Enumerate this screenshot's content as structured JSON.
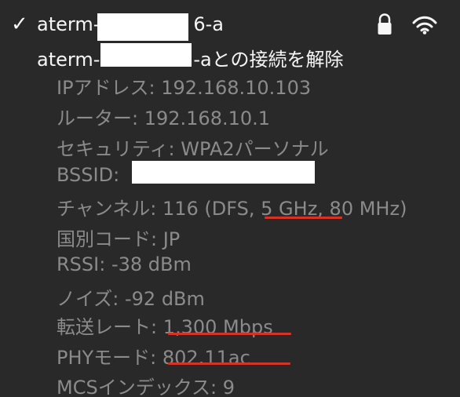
{
  "network": {
    "checkmark": "✓",
    "name_prefix": "aterm-",
    "name_suffix_visible": "6-a",
    "disconnect_prefix": "aterm-",
    "disconnect_suffix": "-aとの接続を解除",
    "lock_icon": "lock-icon",
    "wifi_icon": "wifi-icon"
  },
  "details": {
    "ip": "IPアドレス: 192.168.10.103",
    "router": "ルーター: 192.168.10.1",
    "security": "セキュリティ: WPA2パーソナル",
    "bssid_label": "BSSID:",
    "channel": "チャンネル: 116 (DFS, 5 GHz, 80 MHz)",
    "country": "国別コード: JP",
    "rssi": "RSSI: -38 dBm",
    "noise": "ノイズ: -92 dBm",
    "tx_rate": "転送レート: 1,300 Mbps",
    "phy_mode": "PHYモード: 802.11ac",
    "mcs_index": "MCSインデックス: 9"
  },
  "colors": {
    "background": "#292929",
    "primary_text": "#f6f6f6",
    "secondary_text": "#8b8b8b",
    "highlight_underline": "#d43325",
    "redaction": "#ffffff"
  }
}
